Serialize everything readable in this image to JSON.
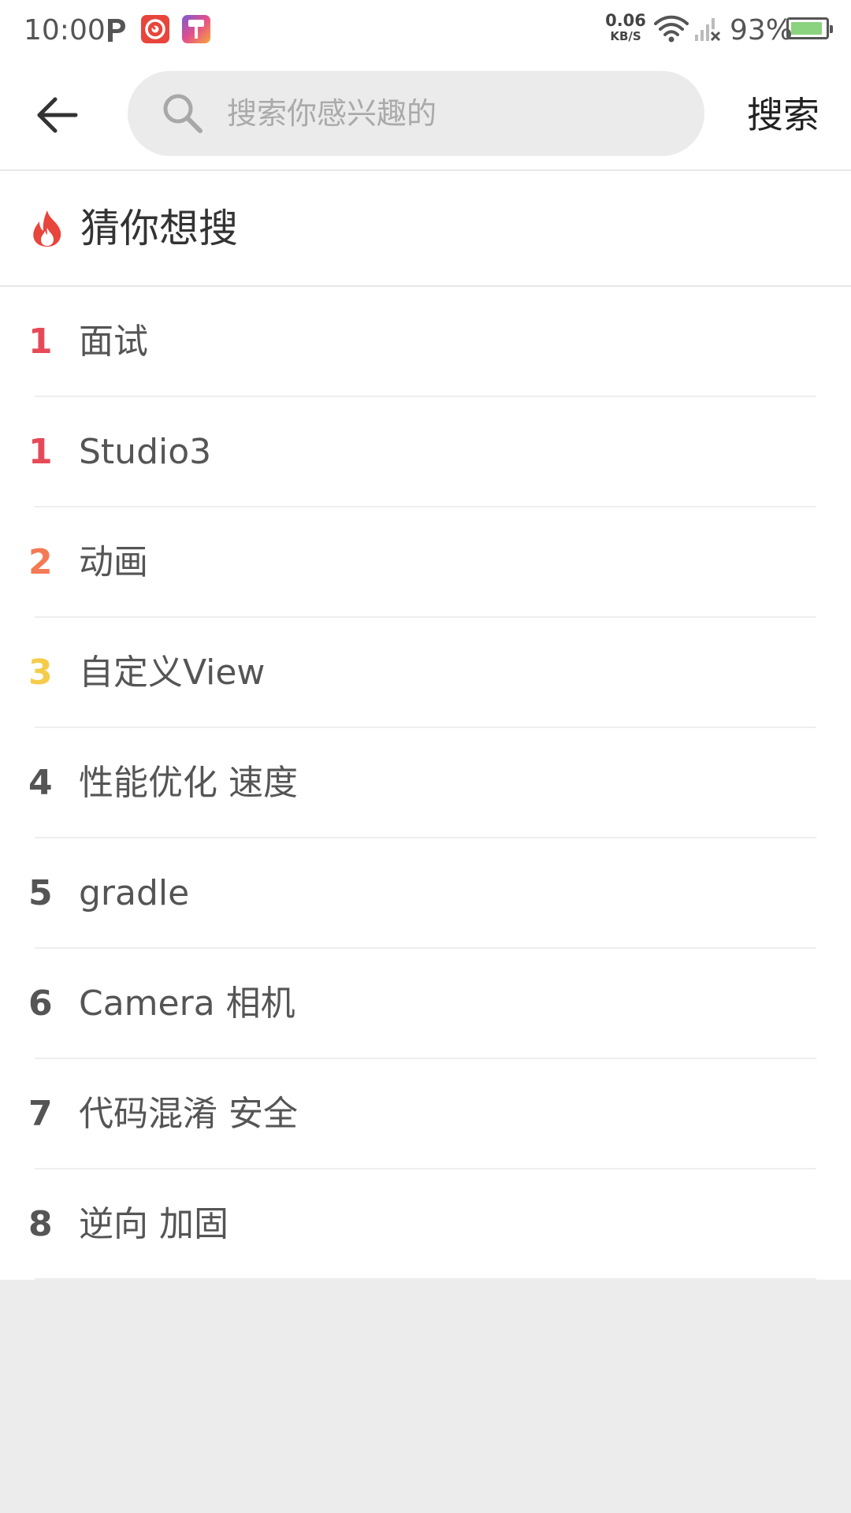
{
  "status_bar": {
    "time": "10:00",
    "net_speed_value": "0.06",
    "net_speed_unit": "KB/S",
    "battery_percent": "93%",
    "battery_level": 0.93,
    "notification_icons": [
      "parking-p-icon",
      "camera-app-icon",
      "paint-roller-app-icon"
    ],
    "system_icons": [
      "wifi-icon",
      "cellular-signal-no-service-icon",
      "battery-icon"
    ],
    "colors": {
      "camera_app": "#e8453c",
      "battery_fill": "#8bd37e"
    }
  },
  "header": {
    "back_icon": "arrow-left-icon",
    "search_icon": "magnifier-icon",
    "search_placeholder": "搜索你感兴趣的",
    "search_value": "",
    "search_button_label": "搜索"
  },
  "section": {
    "icon": "fire-icon",
    "title": "猜你想搜",
    "icon_color": "#e8453c"
  },
  "hot_list": [
    {
      "rank": "1",
      "text": "面试",
      "rank_color": "#e64a58"
    },
    {
      "rank": "1",
      "text": "Studio3",
      "rank_color": "#e64a58"
    },
    {
      "rank": "2",
      "text": "动画",
      "rank_color": "#f47a55"
    },
    {
      "rank": "3",
      "text": "自定义View",
      "rank_color": "#f5cc4a"
    },
    {
      "rank": "4",
      "text": "性能优化 速度",
      "rank_color": "#555555"
    },
    {
      "rank": "5",
      "text": "gradle",
      "rank_color": "#555555"
    },
    {
      "rank": "6",
      "text": "Camera 相机",
      "rank_color": "#555555"
    },
    {
      "rank": "7",
      "text": "代码混淆 安全",
      "rank_color": "#555555"
    },
    {
      "rank": "8",
      "text": "逆向 加固",
      "rank_color": "#555555"
    }
  ]
}
